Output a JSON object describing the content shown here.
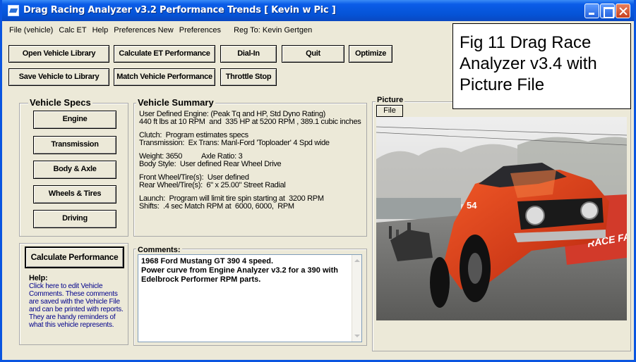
{
  "window": {
    "title": "Drag Racing Analyzer v3.2  Performance Trends  [ Kevin w Pic ]"
  },
  "menu": {
    "items": [
      "File (vehicle)",
      "Calc ET",
      "Help",
      "Preferences New",
      "Preferences"
    ],
    "reg_to": "Reg To: Kevin Gertgen"
  },
  "toolbar": {
    "open_library": "Open Vehicle Library",
    "calculate_et": "Calculate ET Performance",
    "dial_in": "Dial-In",
    "quit": "Quit",
    "optimize": "Optimize",
    "save_library": "Save Vehicle to Library",
    "match_vehicle": "Match Vehicle Performance",
    "throttle_stop": "Throttle Stop"
  },
  "vehicle_specs": {
    "title": "Vehicle Specs",
    "buttons": [
      "Engine",
      "Transmission",
      "Body & Axle",
      "Wheels & Tires",
      "Driving"
    ]
  },
  "vehicle_summary": {
    "title": "Vehicle Summary",
    "paragraphs": [
      "User Defined Engine: (Peak Tq and HP, Std Dyno Rating)\n440 ft lbs at 10 RPM  and  335 HP at 5200 RPM , 389.1 cubic inches",
      "Clutch:  Program estimates specs\nTransmission:  Ex Trans: Manl-Ford 'Toploader' 4 Spd wide",
      "Weight: 3650          Axle Ratio: 3\nBody Style:  User defined Rear Wheel Drive",
      "Front Wheel/Tire(s):  User defined\nRear Wheel/Tire(s):  6\" x 25.00\" Street Radial",
      "Launch:  Program will limit tire spin starting at  3200 RPM\nShifts:  .4 sec Match RPM at  6000, 6000,  RPM"
    ]
  },
  "calculate_performance": "Calculate Performance",
  "help": {
    "heading": "Help:",
    "text": "Click here to edit Vehicle Comments.  These comments are saved with the Vehicle File and can be printed with reports.  They are handy reminders of what this vehicle represents."
  },
  "comments": {
    "title": "Comments:",
    "text": "1968 Ford Mustang GT 390 4 speed.\nPower curve from Engine Analyzer v3.2 for a 390 with Edelbrock Performer RPM parts."
  },
  "picture": {
    "title": "Picture",
    "file_button": "File",
    "car_number": "54",
    "banner_text": "RACE FANS"
  },
  "figure_caption": "Fig 11  Drag Race Analyzer v3.4 with Picture File",
  "colors": {
    "titlebar": "#0a5ce8",
    "window_bg": "#ece9d8",
    "help_text": "#00008b",
    "car_body": "#e8401a"
  }
}
